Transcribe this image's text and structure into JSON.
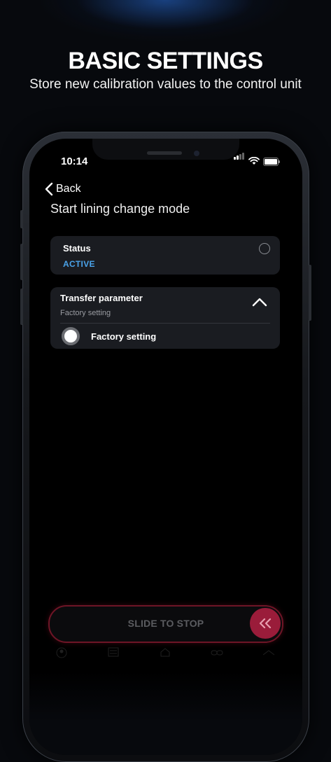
{
  "hero": {
    "title": "BASIC SETTINGS",
    "subtitle": "Store new calibration values to the control unit"
  },
  "status_bar": {
    "time": "10:14",
    "icons": [
      "signal-icon",
      "wifi-icon",
      "battery-icon"
    ]
  },
  "nav": {
    "back_label": "Back",
    "page_title": "Start lining change mode"
  },
  "status_card": {
    "label": "Status",
    "value": "ACTIVE",
    "value_color": "#4aa3ea"
  },
  "parameter_card": {
    "title": "Transfer parameter",
    "selected_value": "Factory setting",
    "expanded": true,
    "options": [
      {
        "label": "Factory setting",
        "selected": true
      }
    ]
  },
  "slider": {
    "label": "SLIDE TO STOP",
    "accent_color": "#9a1c3a"
  },
  "tabbar": {
    "tabs": [
      {
        "icon": "person-icon"
      },
      {
        "icon": "list-icon"
      },
      {
        "icon": "home-icon"
      },
      {
        "icon": "link-icon"
      },
      {
        "icon": "tools-icon"
      }
    ]
  }
}
